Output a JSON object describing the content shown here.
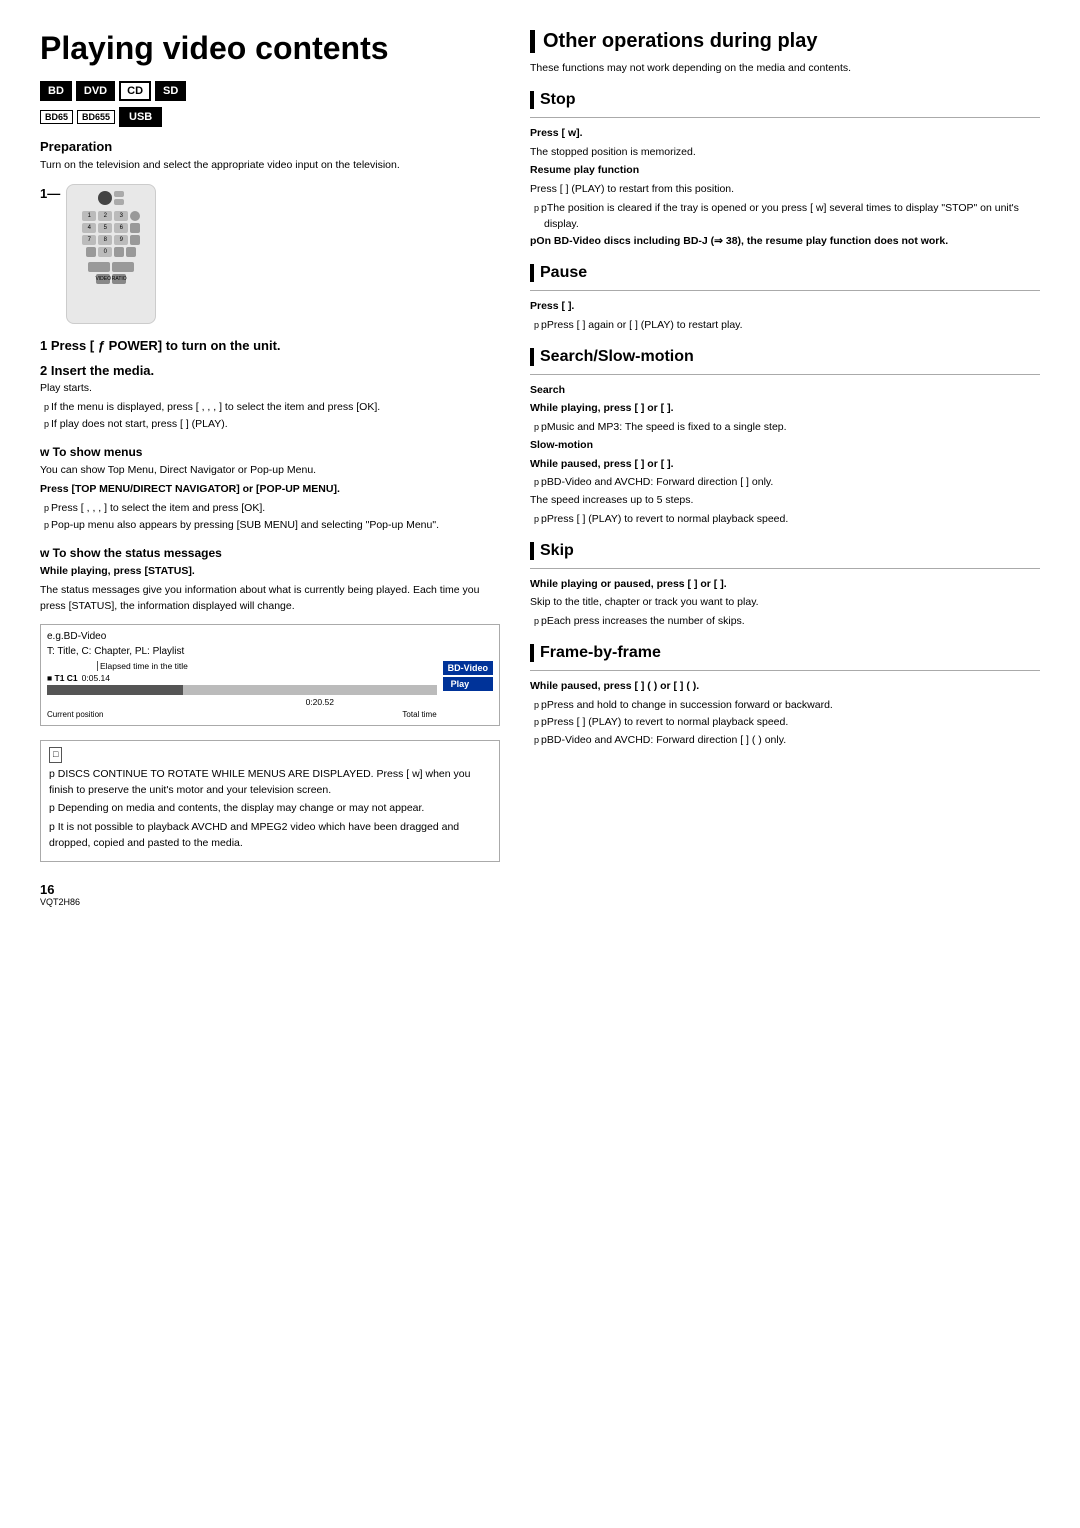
{
  "page": {
    "title": "Playing video contents",
    "page_number": "16",
    "version_code": "VQT2H86"
  },
  "left": {
    "badges": [
      "BD",
      "DVD",
      "CD",
      "SD"
    ],
    "badges_small": [
      "BD65",
      "BD655"
    ],
    "badge_usb": "USB",
    "preparation": {
      "title": "Preparation",
      "text": "Turn on the television and select the appropriate video input on the television."
    },
    "step1": {
      "number": "1",
      "label": "Press [ ƒ POWER] to turn on the unit."
    },
    "step2": {
      "number": "2",
      "label": "Insert the media.",
      "play_starts": "Play starts.",
      "bullets": [
        "pIf the menu is displayed, press [  ,  ,  ,  ] to select the item and press [OK].",
        "pIf play does not start, press [  ] (PLAY)."
      ]
    },
    "show_menus": {
      "title": "w To show menus",
      "intro": "You can show Top Menu, Direct Navigator or Pop-up Menu.",
      "bold_text": "Press [TOP MENU/DIRECT NAVIGATOR] or [POP-UP MENU].",
      "bullets": [
        "pPress [  ,  ,  ,  ] to select the item and press [OK].",
        "pPop-up menu also appears by pressing [SUB MENU] and selecting \"Pop-up Menu\"."
      ]
    },
    "show_status": {
      "title": "w To show the status messages",
      "while_playing": "While playing, press [STATUS].",
      "text": "The status messages give you information about what is currently being played. Each time you press [STATUS], the information displayed will change.",
      "diagram": {
        "label": "e.g.BD-Video",
        "sub_label": "T: Title, C: Chapter, PL: Playlist",
        "elapsed_label": "Elapsed time in the title",
        "t1_c1": "■ T1  C1",
        "time1": "0:05.14",
        "time2": "0:20.52",
        "current_position": "Current position",
        "total_time": "Total time",
        "bd_badge": "BD-Video",
        "play_badge": "Play"
      }
    },
    "notes": [
      "p DISCS CONTINUE TO ROTATE WHILE MENUS ARE DISPLAYED. Press [ w] when you finish to preserve the unit's motor and your television screen.",
      "p Depending on media and contents, the display may change or may not appear.",
      "p It is not possible to playback AVCHD and MPEG2 video which have been dragged and dropped, copied and pasted to the media."
    ]
  },
  "right": {
    "section_title": "Other operations during play",
    "intro": "These functions may not work depending on the media and contents.",
    "stop": {
      "title": "Stop",
      "press_label": "Press [ w].",
      "memorized": "The stopped position is memorized.",
      "resume_title": "Resume play function",
      "resume_text": "Press [  ] (PLAY) to restart from this position.",
      "note1": "pThe position is cleared if the tray is opened or you press [ w] several times to display \"STOP\" on unit's display.",
      "note2": "pOn BD-Video discs including BD-J (⇒ 38), the resume play function does not work."
    },
    "pause": {
      "title": "Pause",
      "press_label": "Press [  ].",
      "text": "pPress [  ] again or [  ] (PLAY) to restart play."
    },
    "search_slow": {
      "title": "Search/Slow-motion",
      "search_title": "Search",
      "search_text": "While playing, press [     ] or [     ].",
      "search_note": "pMusic and MP3: The speed is fixed to a single step.",
      "slow_title": "Slow-motion",
      "slow_text": "While paused, press [     ] or [     ].",
      "slow_note1": "pBD-Video and AVCHD: Forward direction [     ] only.",
      "slow_note2": "The speed increases up to 5 steps.",
      "slow_note3": "pPress [  ] (PLAY) to revert to normal playback speed."
    },
    "skip": {
      "title": "Skip",
      "text": "While playing or paused, press [     ] or [     ].",
      "note1": "Skip to the title, chapter or track you want to play.",
      "note2": "pEach press increases the number of skips."
    },
    "frame_by_frame": {
      "title": "Frame-by-frame",
      "text": "While paused, press [  ] (    ) or [  ] (    ).",
      "note1": "pPress and hold to change in succession forward or backward.",
      "note2": "pPress [  ] (PLAY) to revert to normal playback speed.",
      "note3": "pBD-Video and AVCHD: Forward direction [  ] (     ) only."
    }
  }
}
